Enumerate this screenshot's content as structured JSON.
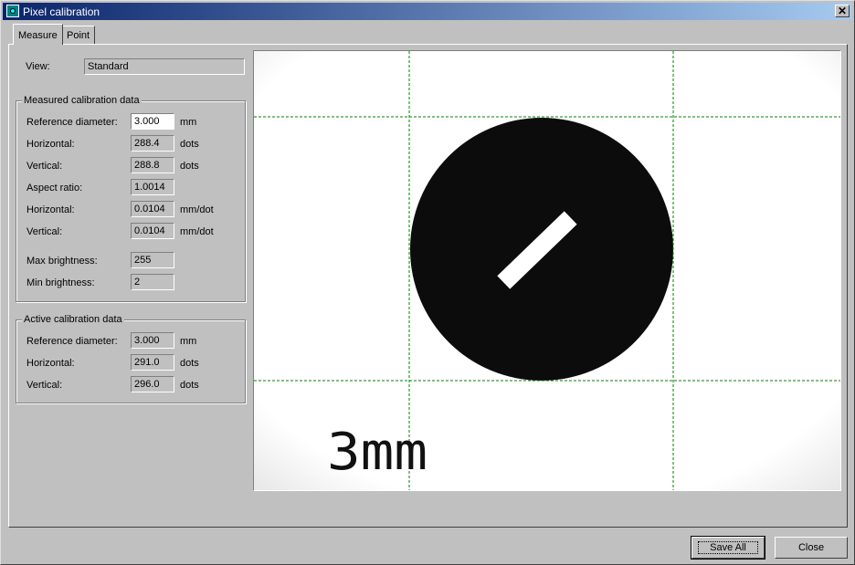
{
  "window": {
    "title": "Pixel calibration",
    "title_icon": "calibration-app-icon",
    "close_glyph": "✕"
  },
  "tabs": [
    {
      "label": "Measure",
      "active": true
    },
    {
      "label": "Point",
      "active": false
    }
  ],
  "view": {
    "label": "View:",
    "value": "Standard"
  },
  "measured": {
    "title": "Measured calibration data",
    "reference_diameter": {
      "label": "Reference diameter:",
      "value": "3.000",
      "unit": "mm"
    },
    "horizontal": {
      "label": "Horizontal:",
      "value": "288.4",
      "unit": "dots"
    },
    "vertical": {
      "label": "Vertical:",
      "value": "288.8",
      "unit": "dots"
    },
    "aspect_ratio": {
      "label": "Aspect ratio:",
      "value": "1.0014"
    },
    "horizontal_mm": {
      "label": "Horizontal:",
      "value": "0.0104",
      "unit": "mm/dot"
    },
    "vertical_mm": {
      "label": "Vertical:",
      "value": "0.0104",
      "unit": "mm/dot"
    },
    "max_brightness": {
      "label": "Max brightness:",
      "value": "255"
    },
    "min_brightness": {
      "label": "Min brightness:",
      "value": "2"
    }
  },
  "active": {
    "title": "Active calibration data",
    "reference_diameter": {
      "label": "Reference diameter:",
      "value": "3.000",
      "unit": "mm"
    },
    "horizontal": {
      "label": "Horizontal:",
      "value": "291.0",
      "unit": "dots"
    },
    "vertical": {
      "label": "Vertical:",
      "value": "296.0",
      "unit": "dots"
    }
  },
  "image": {
    "scale_text": "3mm",
    "grid_color": "#008000"
  },
  "buttons": {
    "save_all": "Save All",
    "close": "Close"
  }
}
